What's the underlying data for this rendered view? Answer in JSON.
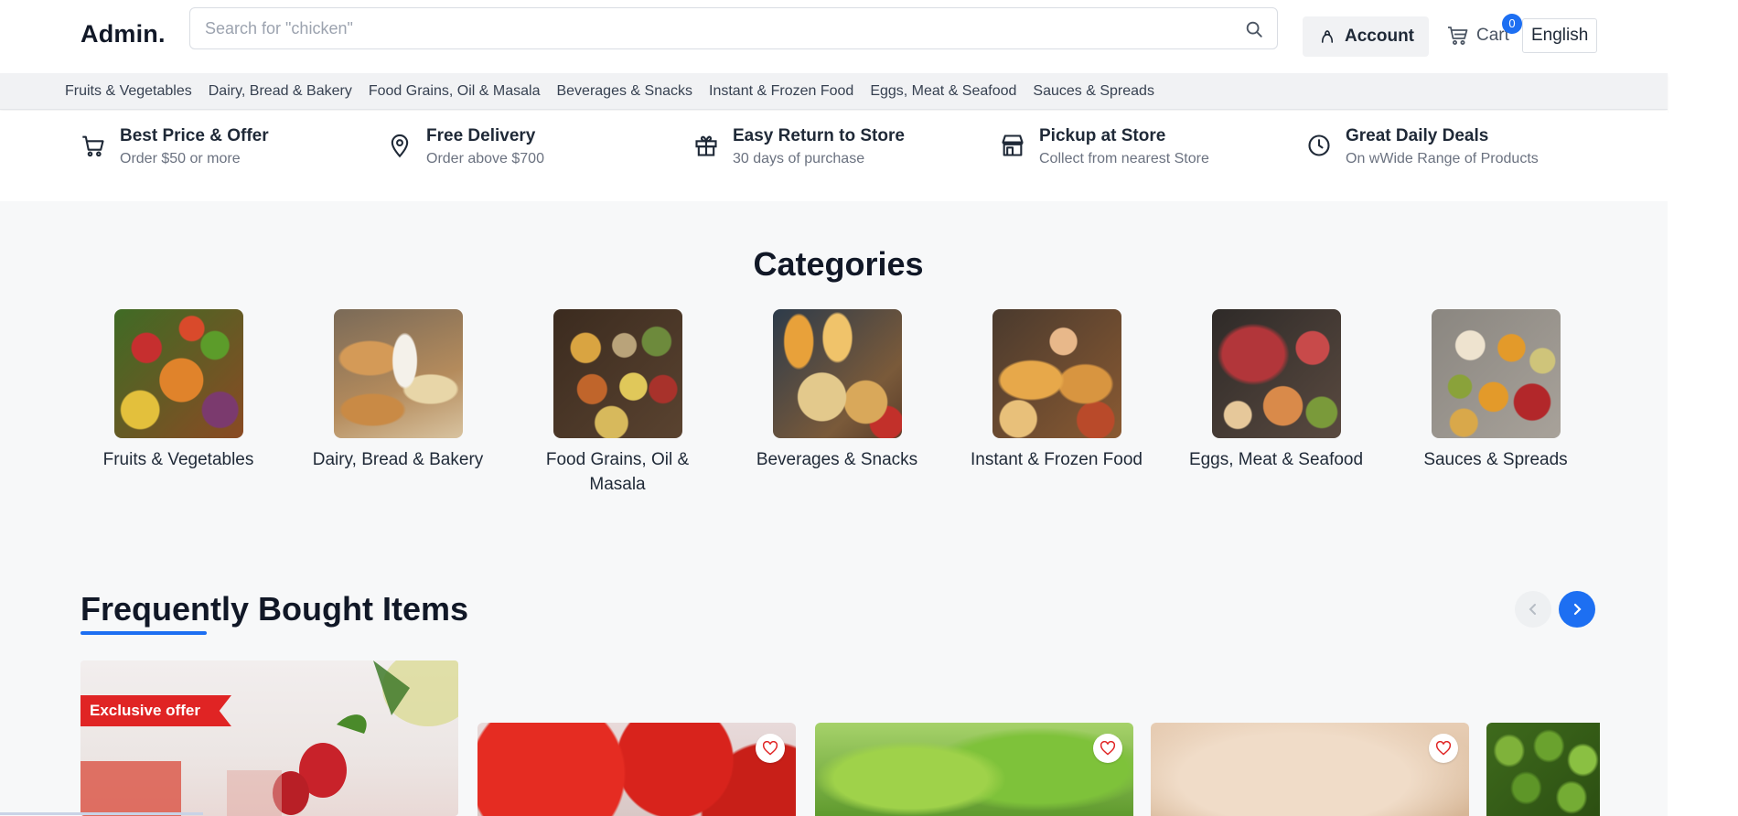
{
  "header": {
    "logo": "Admin.",
    "search_placeholder": "Search for \"chicken\"",
    "account_label": "Account",
    "cart_label": "Cart",
    "cart_count": "0",
    "language": "English"
  },
  "nav": {
    "items": [
      "Fruits & Vegetables",
      "Dairy, Bread & Bakery",
      "Food Grains, Oil & Masala",
      "Beverages & Snacks",
      "Instant & Frozen Food",
      "Eggs, Meat & Seafood",
      "Sauces & Spreads"
    ]
  },
  "features": [
    {
      "title": "Best Price & Offer",
      "subtitle": "Order $50 or more",
      "icon": "cart-icon"
    },
    {
      "title": "Free Delivery",
      "subtitle": "Order above $700",
      "icon": "location-pin-icon"
    },
    {
      "title": "Easy Return to Store",
      "subtitle": "30 days of purchase",
      "icon": "gift-icon"
    },
    {
      "title": "Pickup at Store",
      "subtitle": "Collect from nearest Store",
      "icon": "store-icon"
    },
    {
      "title": "Great Daily Deals",
      "subtitle": "On wWide Range of Products",
      "icon": "clock-icon"
    }
  ],
  "categories": {
    "heading": "Categories",
    "items": [
      {
        "label": "Fruits & Vegetables",
        "image": "fruits-vegetables-image"
      },
      {
        "label": "Dairy, Bread & Bakery",
        "image": "dairy-bread-bakery-image"
      },
      {
        "label": "Food Grains, Oil & Masala",
        "image": "food-grains-oil-masala-image"
      },
      {
        "label": "Beverages & Snacks",
        "image": "beverages-snacks-image"
      },
      {
        "label": "Instant & Frozen Food",
        "image": "instant-frozen-food-image"
      },
      {
        "label": "Eggs, Meat & Seafood",
        "image": "eggs-meat-seafood-image"
      },
      {
        "label": "Sauces & Spreads",
        "image": "sauces-spreads-image"
      }
    ]
  },
  "frequently_bought": {
    "heading": "Frequently Bought Items",
    "promo_badge": "Exclusive offer",
    "products": [
      {
        "image": "tomatoes-image"
      },
      {
        "image": "lettuce-image"
      },
      {
        "image": "flour-image"
      },
      {
        "image": "green-olives-image"
      }
    ]
  },
  "colors": {
    "accent": "#1d6ff2",
    "badge_red": "#e02424",
    "nav_bg": "#f1f2f4",
    "page_bg": "#f7f8f9"
  }
}
